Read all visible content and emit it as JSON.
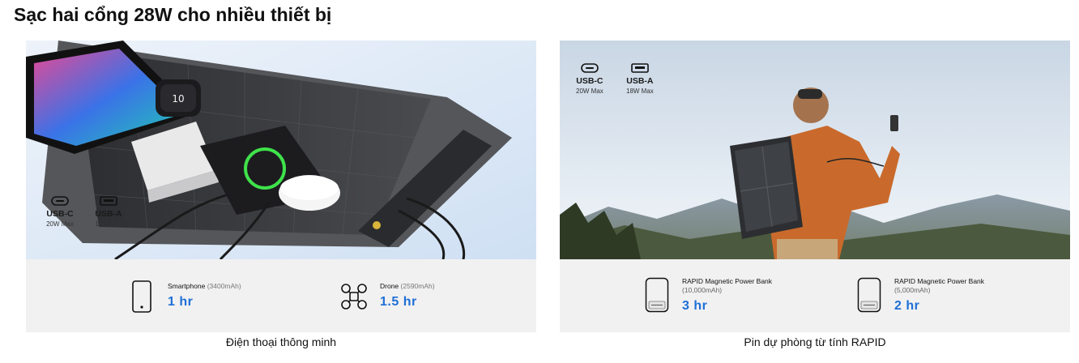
{
  "page": {
    "title": "Sạc hai cổng 28W cho nhiều thiết bị"
  },
  "cards": [
    {
      "ports": [
        {
          "name": "USB-C",
          "spec": "20W Max",
          "icon": "usb-c-port-icon"
        },
        {
          "name": "USB-A",
          "spec": "18W Max",
          "icon": "usb-a-port-icon"
        }
      ],
      "stats": [
        {
          "label": "Smartphone",
          "capacity": "(3400mAh)",
          "value": "1 hr",
          "icon": "smartphone-icon"
        },
        {
          "label": "Drone",
          "capacity": "(2590mAh)",
          "value": "1.5 hr",
          "icon": "drone-icon"
        }
      ],
      "caption": "Điện thoại thông minh"
    },
    {
      "ports": [
        {
          "name": "USB-C",
          "spec": "20W Max",
          "icon": "usb-c-port-icon"
        },
        {
          "name": "USB-A",
          "spec": "18W Max",
          "icon": "usb-a-port-icon"
        }
      ],
      "stats": [
        {
          "label": "RAPID Magnetic Power Bank",
          "capacity": "(10,000mAh)",
          "value": "3 hr",
          "icon": "power-bank-icon"
        },
        {
          "label": "RAPID Magnetic Power Bank",
          "capacity": "(5,000mAh)",
          "value": "2 hr",
          "icon": "power-bank-icon"
        }
      ],
      "caption": "Pin dự phòng từ tính RAPID"
    }
  ],
  "colors": {
    "accent": "#1f6fd6",
    "stats_bg": "#f1f1f1",
    "sky_light": "#dfeaf6",
    "panel_dark": "#3b3c3f"
  }
}
